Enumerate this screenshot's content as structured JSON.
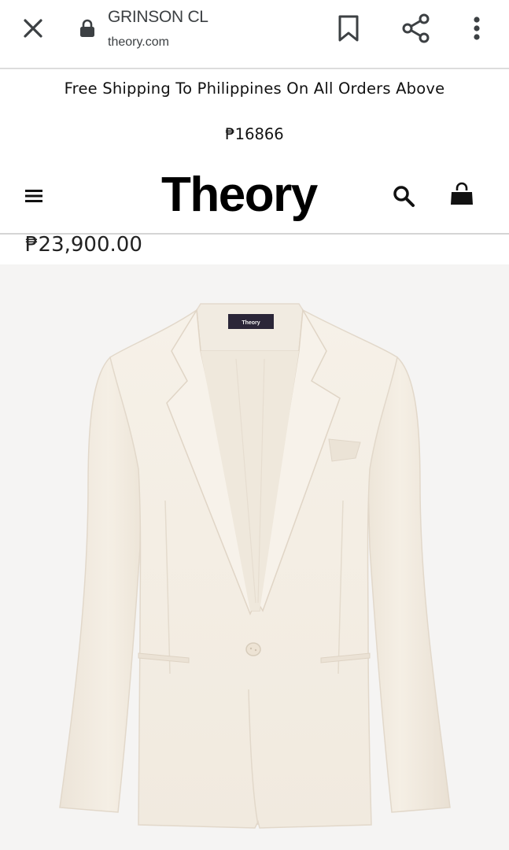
{
  "browser": {
    "title": "GRINSON CL",
    "url": "theory.com",
    "icons": [
      "close-icon",
      "lock-icon",
      "bookmark-icon",
      "share-icon",
      "more-vert-icon"
    ]
  },
  "promo": {
    "line1": "Free Shipping To Philippines On All Orders Above",
    "line2": "₱16866"
  },
  "header": {
    "logo": "Theory",
    "icons": [
      "menu-icon",
      "search-icon",
      "shopping-bag-icon"
    ]
  },
  "product": {
    "price": "₱23,900.00",
    "label_text": "Theory",
    "image_description_colors": {
      "background": "#f5f4f3",
      "garment": "#f3ede3"
    }
  }
}
